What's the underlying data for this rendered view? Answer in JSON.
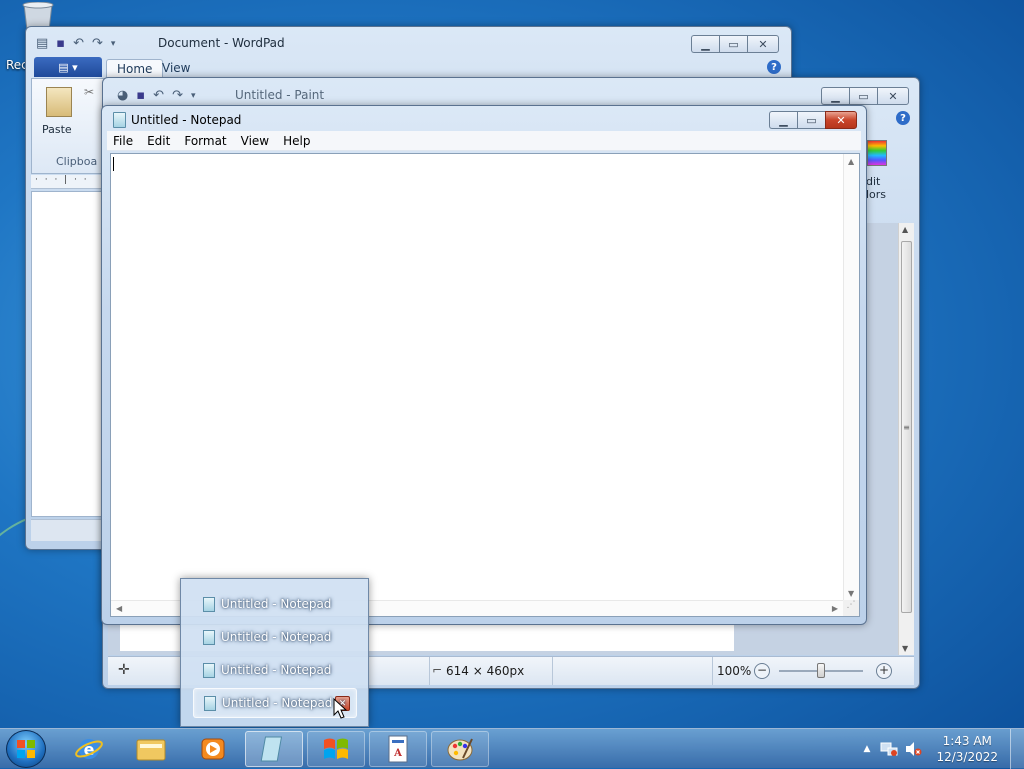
{
  "desktop": {
    "recycle_label": "Rec"
  },
  "wordpad": {
    "title": "Document - WordPad",
    "tabs": [
      "Home",
      "View"
    ],
    "paste_label": "Paste",
    "group_label": "Clipboa",
    "ruler": "· · · | · ·"
  },
  "paint": {
    "title": "Untitled - Paint",
    "edit_colors_line1": "dit",
    "edit_colors_line2": "lors",
    "status": {
      "dimensions": "614 × 460px",
      "zoom": "100%"
    }
  },
  "notepad": {
    "title": "Untitled - Notepad",
    "menu": [
      "File",
      "Edit",
      "Format",
      "View",
      "Help"
    ],
    "content": ""
  },
  "jumplist": {
    "items": [
      "Untitled - Notepad",
      "Untitled - Notepad",
      "Untitled - Notepad",
      "Untitled - Notepad"
    ]
  },
  "taskbar": {
    "time": "1:43 AM",
    "date": "12/3/2022"
  },
  "icons": {
    "recycle_bin": "recycle-bin-icon",
    "start": "windows-logo-icon",
    "ie": "internet-explorer-icon",
    "explorer": "folder-icon",
    "media": "media-player-icon",
    "notepad": "notepad-icon",
    "wordpad": "wordpad-icon",
    "paint": "paint-icon"
  },
  "colors": {
    "desktop": "#1f76c4",
    "close_button": "#c9452a",
    "window_frame": "#c6d8ee"
  }
}
